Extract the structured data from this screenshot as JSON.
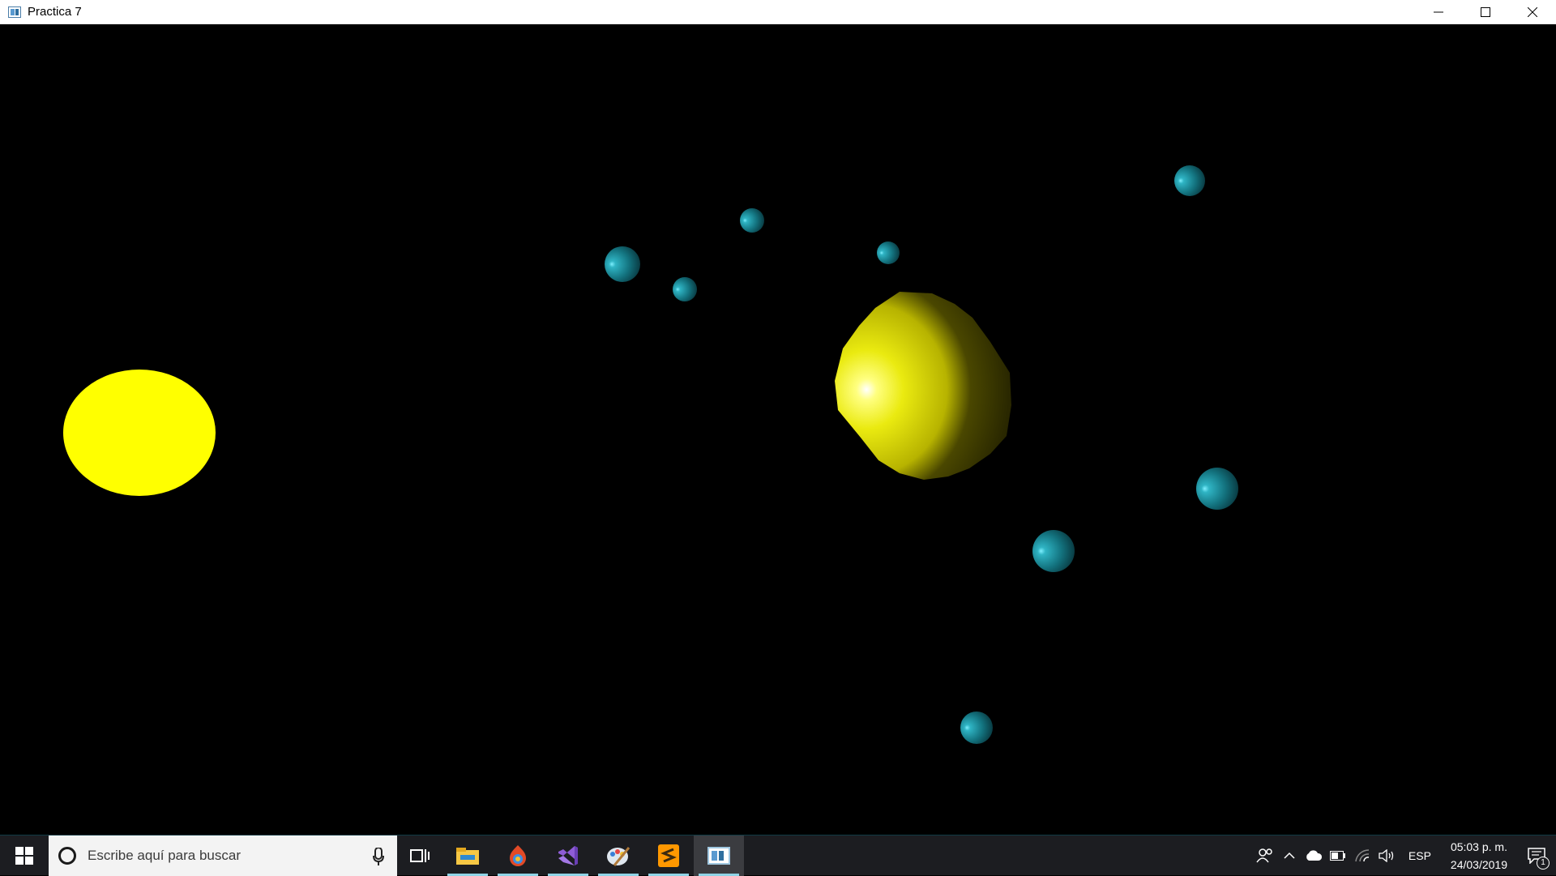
{
  "window": {
    "title": "Practica 7"
  },
  "scene": {
    "background": "#000000",
    "sun_color": "#ffff00",
    "shaded_sphere_color": "#e8e000",
    "moon_color": "#2aa3b0"
  },
  "taskbar": {
    "search_placeholder": "Escribe aquí para buscar",
    "apps": [
      "file-explorer",
      "google-chrome",
      "visual-studio",
      "paint",
      "sublime-text",
      "opengl-window"
    ],
    "language": "ESP",
    "time": "05:03 p. m.",
    "date": "24/03/2019",
    "notification_count": "1"
  }
}
